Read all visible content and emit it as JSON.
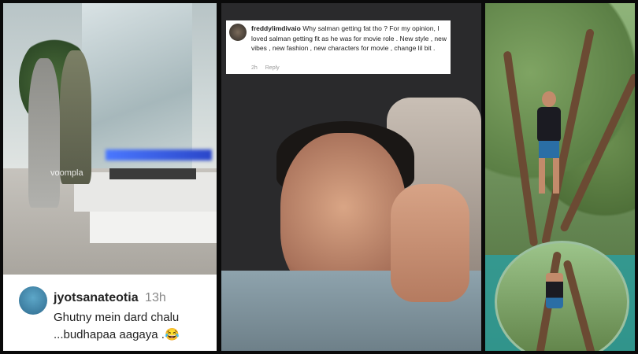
{
  "left_panel": {
    "watermark": "voompla",
    "comment": {
      "username": "jyotsanateotia",
      "time": "13h",
      "text": "Ghutny mein dard chalu ...budhapaa aagaya .😂"
    }
  },
  "middle_panel": {
    "comment": {
      "username": "freddylimdivaio",
      "text": "Why salman getting fat tho ? For my opinion, I loved salman getting fit as he was for movie role . New style , new vibes , new fashion , new characters for movie , change lil bit .",
      "time": "2h",
      "reply_label": "Reply"
    }
  }
}
